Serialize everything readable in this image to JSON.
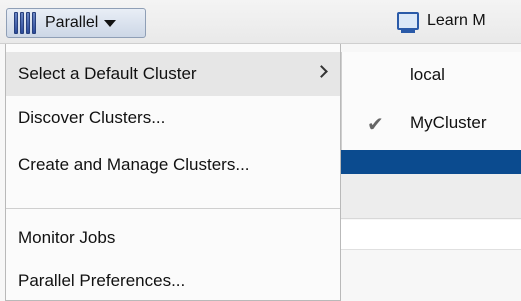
{
  "toolbar": {
    "parallel_label": "Parallel",
    "learn_label": "Learn M"
  },
  "menu": {
    "items": [
      {
        "label": "Select a Default Cluster",
        "has_submenu": true
      },
      {
        "label": "Discover Clusters..."
      },
      {
        "label": "Create and Manage Clusters..."
      },
      {
        "label": "Monitor Jobs"
      },
      {
        "label": "Parallel Preferences..."
      }
    ]
  },
  "submenu": {
    "items": [
      {
        "label": "local",
        "checked": false
      },
      {
        "label": "MyCluster",
        "checked": true
      }
    ]
  },
  "colors": {
    "accent_blue": "#0b4b8f",
    "menu_highlight": "#e6e6e6"
  }
}
